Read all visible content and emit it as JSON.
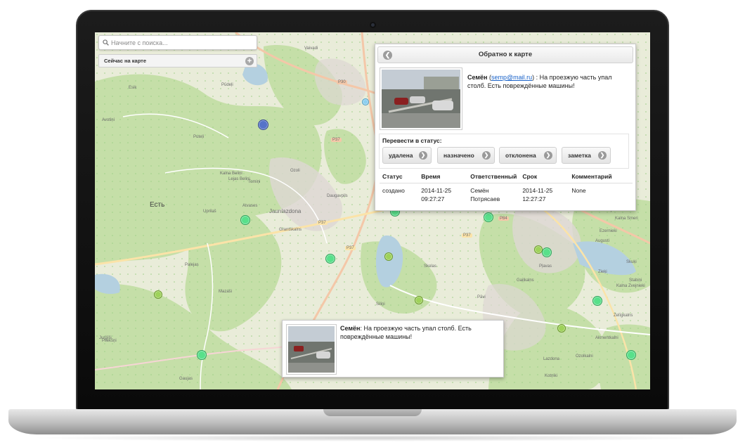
{
  "search": {
    "placeholder": "Начните с поиска..."
  },
  "now_on_map": {
    "label": "Сейчас на карте"
  },
  "map": {
    "labels": [
      "Vaivadi",
      "Esik",
      "Avotiņi",
      "Pūdeļi",
      "Puteļi",
      "Kalna Beliņi",
      "Lejas Beliņi",
      "Tomiņi",
      "Ozoli",
      "Daugavpils",
      "Atvases",
      "Uprilaš",
      "Jaunlazdona",
      "Grantskalns",
      "Palejas",
      "Mazaši",
      "Pliekšņi",
      "Siliņi",
      "Gaiļkalns",
      "Skolas",
      "Pāvi",
      "Pļavas",
      "Gaujas",
      "Ezernieki",
      "Zvejnieki",
      "Kalna Smeri",
      "Augusti",
      "Skuķi",
      "Zieķi",
      "Stabiņi",
      "Kalna Zvejnieki",
      "Zelīgkalns",
      "Akmentkalni",
      "Ozolkalni",
      "Lazdona",
      "Kotņiki",
      "Jurģīši"
    ],
    "big_label": "Есть",
    "road_labels": [
      "P30",
      "P37",
      "P37",
      "P37",
      "P84",
      "P37"
    ]
  },
  "panel": {
    "title": "Обратно к карте",
    "author": "Семён",
    "email": "semp@mail.ru",
    "message": "На проезжую часть упал столб. Есть повреждённые машины!",
    "status_label": "Перевести в статус:",
    "status_buttons": [
      "удалена",
      "назначено",
      "отклонена",
      "заметка"
    ],
    "table": {
      "headers": [
        "Статус",
        "Время",
        "Ответственный",
        "Срок",
        "Комментарий"
      ],
      "rows": [
        [
          "создано",
          "2014-11-25 09:27:27",
          "Семён Потрясаев",
          "2014-11-25 12:27:27",
          "None"
        ]
      ]
    }
  },
  "popup": {
    "author": "Семён",
    "message": "На проезжую часть упал столб. Есть повреждённые машины!"
  },
  "colors": {
    "marker_green": "#58e08a",
    "marker_olive": "#9ed25a",
    "marker_blue": "#5573c9",
    "link": "#1a63c9",
    "forest": "#c5dfa8",
    "map_base": "#e9ecd9"
  }
}
